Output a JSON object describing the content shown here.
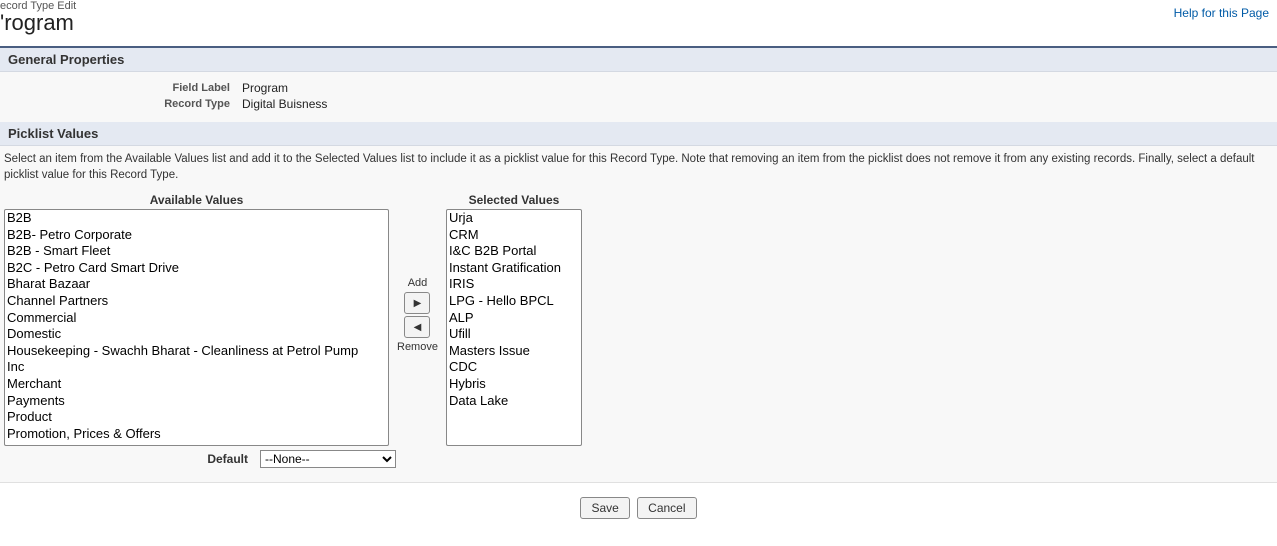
{
  "header": {
    "subtitle": "ecord Type Edit",
    "title": "'rogram",
    "help_link": "Help for this Page"
  },
  "section_general": {
    "title": "General Properties",
    "field_label_lbl": "Field Label",
    "field_label_val": "Program",
    "record_type_lbl": "Record Type",
    "record_type_val": "Digital Buisness"
  },
  "section_picklist": {
    "title": "Picklist Values",
    "help_text": "Select an item from the Available Values list and add it to the Selected Values list to include it as a picklist value for this Record Type. Note that removing an item from the picklist does not remove it from any existing records. Finally, select a default picklist value for this Record Type.",
    "available_title": "Available Values",
    "selected_title": "Selected Values",
    "add_label": "Add",
    "remove_label": "Remove",
    "default_label": "Default",
    "default_options": [
      "--None--"
    ],
    "available": [
      "B2B",
      "B2B- Petro Corporate",
      "B2B - Smart Fleet",
      "B2C - Petro Card Smart Drive",
      "Bharat Bazaar",
      "Channel Partners",
      "Commercial",
      "Domestic",
      "Housekeeping - Swachh Bharat - Cleanliness at Petrol Pump",
      "Inc",
      "Merchant",
      "Payments",
      "Product",
      "Promotion, Prices & Offers"
    ],
    "selected": [
      "Urja",
      "CRM",
      "I&C B2B Portal",
      "Instant Gratification",
      "IRIS",
      "LPG - Hello BPCL",
      "ALP",
      "Ufill",
      "Masters Issue",
      "CDC",
      "Hybris",
      "Data Lake"
    ]
  },
  "footer": {
    "save": "Save",
    "cancel": "Cancel"
  }
}
